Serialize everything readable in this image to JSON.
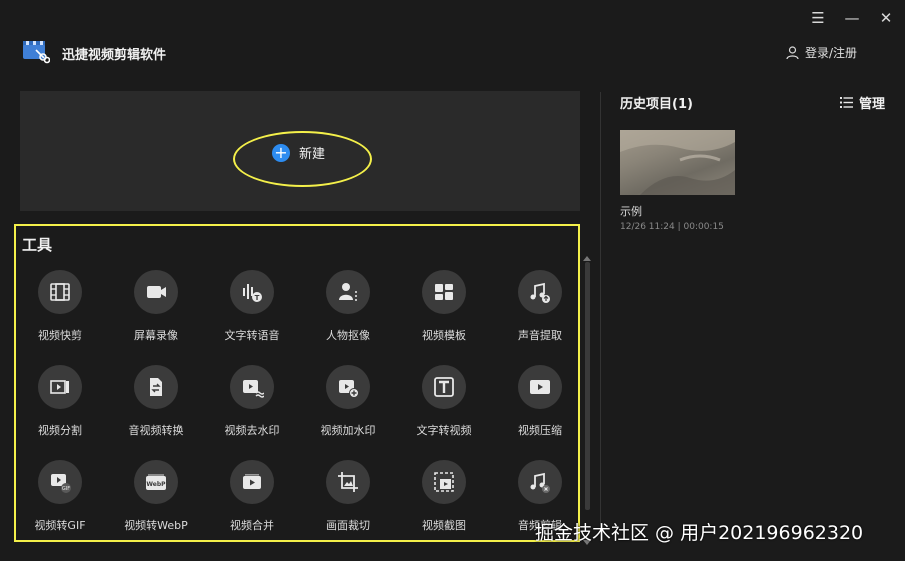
{
  "app": {
    "title": "迅捷视频剪辑软件",
    "logo_icon": "scissors-clapper-icon",
    "login_label": "登录/注册"
  },
  "window_controls": [
    "menu-icon",
    "minimize-icon",
    "close-icon"
  ],
  "new_project": {
    "label": "新建"
  },
  "tools": {
    "title": "工具",
    "items": [
      {
        "label": "视频快剪",
        "icon": "film-icon"
      },
      {
        "label": "屏幕录像",
        "icon": "camera-icon"
      },
      {
        "label": "文字转语音",
        "icon": "text-to-speech-icon"
      },
      {
        "label": "人物抠像",
        "icon": "person-cutout-icon"
      },
      {
        "label": "视频模板",
        "icon": "template-icon"
      },
      {
        "label": "声音提取",
        "icon": "music-extract-icon"
      },
      {
        "label": "视频分割",
        "icon": "split-icon"
      },
      {
        "label": "音视频转换",
        "icon": "convert-icon"
      },
      {
        "label": "视频去水印",
        "icon": "remove-watermark-icon"
      },
      {
        "label": "视频加水印",
        "icon": "add-watermark-icon"
      },
      {
        "label": "文字转视频",
        "icon": "text-to-video-icon"
      },
      {
        "label": "视频压缩",
        "icon": "compress-icon"
      },
      {
        "label": "视频转GIF",
        "icon": "gif-icon"
      },
      {
        "label": "视频转WebP",
        "icon": "webp-icon"
      },
      {
        "label": "视频合并",
        "icon": "merge-icon"
      },
      {
        "label": "画面裁切",
        "icon": "crop-icon"
      },
      {
        "label": "视频截图",
        "icon": "screenshot-icon"
      },
      {
        "label": "音频剪辑",
        "icon": "audio-clip-icon"
      }
    ]
  },
  "history": {
    "title": "历史项目(1)",
    "manage_label": "管理",
    "items": [
      {
        "name": "示例",
        "meta": "12/26 11:24 | 00:00:15"
      }
    ]
  },
  "watermark": "掘金技术社区 @ 用户202196962320",
  "colors": {
    "accent": "#2d8cf0",
    "highlight": "#f4f04a",
    "background": "#1b1b1b",
    "panel": "#2a2a2a"
  }
}
